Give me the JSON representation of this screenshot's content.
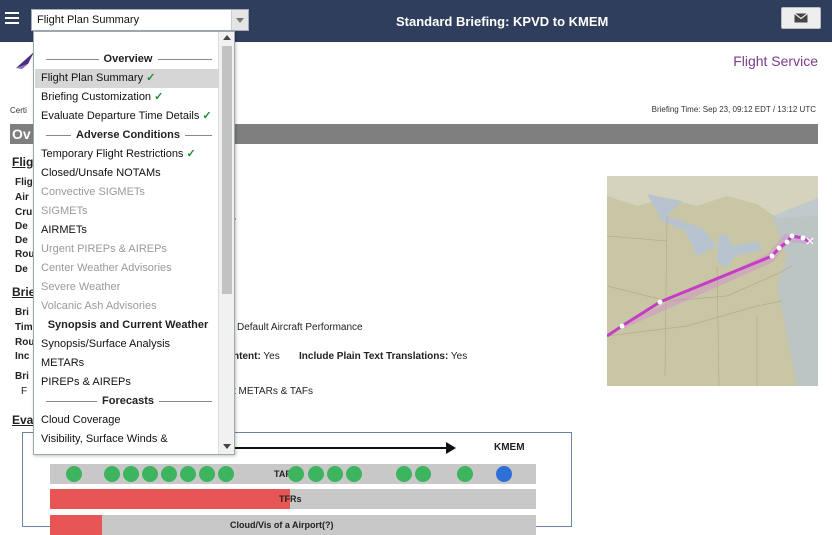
{
  "header": {
    "select_value": "Flight Plan Summary",
    "title": "Standard Briefing: KPVD to KMEM"
  },
  "page": {
    "flight_service": "Flight Service",
    "cert_prefix": "Certi",
    "briefing_time": "Briefing Time: Sep 23, 09:12 EDT / 13:12 UTC",
    "section_fragment": "Ov",
    "flight_plan_fragment": "Fligh",
    "flight_labels": [
      "Flig",
      "Air",
      "Cru",
      "De",
      "De",
      "Rou",
      "De"
    ],
    "briefing_fragment": "Brie",
    "briefing_labels": [
      "Bri",
      "Tim",
      "Rou",
      "Inc"
    ],
    "brief_fragment": "Bri",
    "f_fragment": "F",
    "default_aircraft_perf": "Default Aircraft Performance",
    "content_label": "ntent:",
    "content_value": "Yes",
    "plain_text_label": "Include Plain Text Translations:",
    "plain_text_value": "Yes",
    "metars_tafs": "t METARs & TAFs",
    "eval_fragment": "Eva",
    "dash_fragment": "-"
  },
  "timeline": {
    "destination": "KMEM",
    "tafs_label": "TAFs",
    "tfrs_label": "TFRs",
    "cloud_label": "Cloud/Vis of a Airport(?)"
  },
  "dropdown": {
    "items": [
      {
        "type": "group",
        "label": "Overview"
      },
      {
        "type": "item",
        "label": "Flight Plan Summary",
        "check": "✓",
        "selected": true
      },
      {
        "type": "item",
        "label": "Briefing Customization",
        "check": "✓"
      },
      {
        "type": "item",
        "label": "Evaluate Departure Time Details",
        "check": "✓"
      },
      {
        "type": "group",
        "label": "Adverse Conditions"
      },
      {
        "type": "item",
        "label": "Temporary Flight Restrictions",
        "check": "✓"
      },
      {
        "type": "item",
        "label": "Closed/Unsafe NOTAMs"
      },
      {
        "type": "item",
        "label": "Convective SIGMETs",
        "disabled": true
      },
      {
        "type": "item",
        "label": "SIGMETs",
        "disabled": true
      },
      {
        "type": "item",
        "label": "AIRMETs"
      },
      {
        "type": "item",
        "label": "Urgent PIREPs & AIREPs",
        "disabled": true
      },
      {
        "type": "item",
        "label": "Center Weather Advisories",
        "disabled": true
      },
      {
        "type": "item",
        "label": "Severe Weather",
        "disabled": true
      },
      {
        "type": "item",
        "label": "Volcanic Ash Advisories",
        "disabled": true
      },
      {
        "type": "group",
        "label": "Synopsis and Current Weather"
      },
      {
        "type": "item",
        "label": "Synopsis/Surface Analysis"
      },
      {
        "type": "item",
        "label": "METARs"
      },
      {
        "type": "item",
        "label": "PIREPs & AIREPs"
      },
      {
        "type": "group",
        "label": "Forecasts"
      },
      {
        "type": "item",
        "label": "Cloud Coverage"
      },
      {
        "type": "item",
        "label": "Visibility, Surface Winds &"
      }
    ]
  },
  "colors": {
    "header_bg": "#2e3e5c",
    "accent_purple": "#7a3b8c",
    "check_green": "#1f8b2c",
    "dot_green": "#3cb55e",
    "dot_blue": "#2f6fd8",
    "tfr_red": "#e85555"
  },
  "icons": [
    "hamburger-menu-icon",
    "mail-icon",
    "logo-icon",
    "scroll-up-icon",
    "scroll-down-icon",
    "checkmark-icon"
  ]
}
